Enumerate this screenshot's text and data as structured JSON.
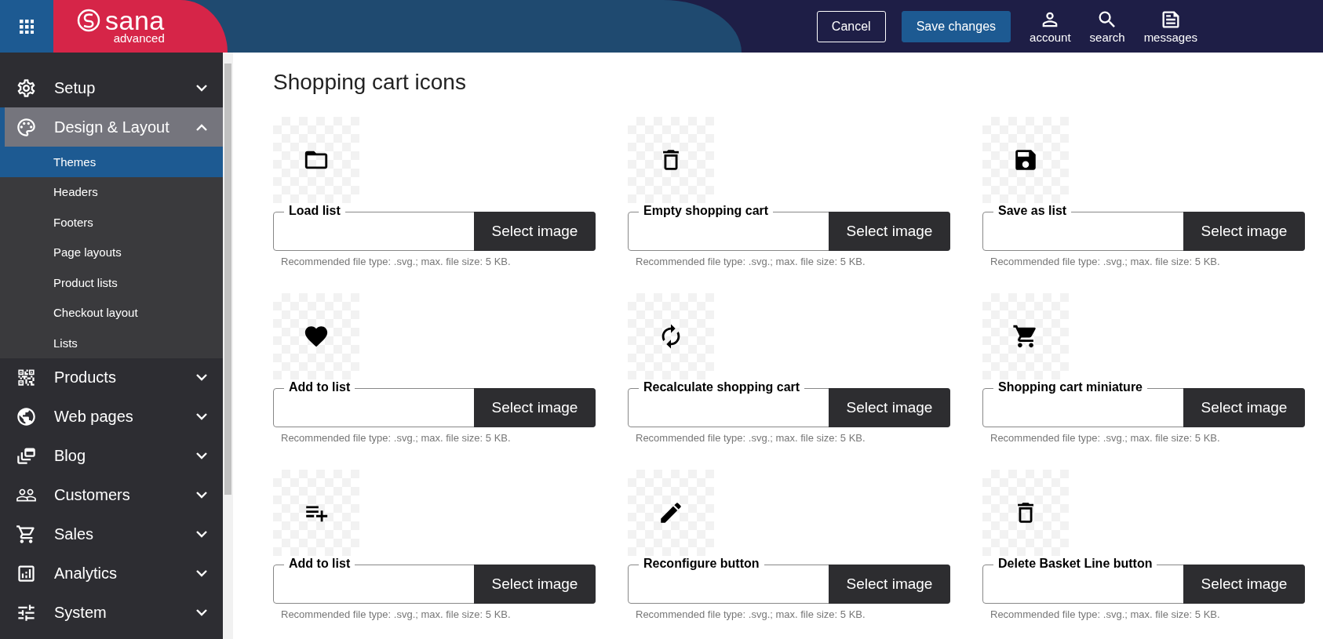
{
  "header": {
    "logo_text": "sana",
    "logo_subtext": "advanced",
    "buttons": [
      {
        "label": "Cancel",
        "kind": "outline"
      },
      {
        "label": "Save changes",
        "kind": "primary"
      }
    ],
    "actions": [
      {
        "label": "account"
      },
      {
        "label": "search"
      },
      {
        "label": "messages"
      }
    ]
  },
  "sidebar": {
    "items": [
      {
        "label": "Setup",
        "expanded": false
      },
      {
        "label": "Design & Layout",
        "expanded": true,
        "children": [
          {
            "label": "Themes",
            "selected": true
          },
          {
            "label": "Headers",
            "selected": false
          },
          {
            "label": "Footers",
            "selected": false
          },
          {
            "label": "Page layouts",
            "selected": false
          },
          {
            "label": "Product lists",
            "selected": false
          },
          {
            "label": "Checkout layout",
            "selected": false
          },
          {
            "label": "Lists",
            "selected": false
          }
        ]
      },
      {
        "label": "Products",
        "expanded": false
      },
      {
        "label": "Web pages",
        "expanded": false
      },
      {
        "label": "Blog",
        "expanded": false
      },
      {
        "label": "Customers",
        "expanded": false
      },
      {
        "label": "Sales",
        "expanded": false
      },
      {
        "label": "Analytics",
        "expanded": false
      },
      {
        "label": "System",
        "expanded": false
      }
    ]
  },
  "section": {
    "title": "Shopping cart icons",
    "fields": [
      {
        "label": "Load list",
        "button": "Select image",
        "hint": "Recommended file type: .svg.; max. file size: 5 KB."
      },
      {
        "label": "Empty shopping cart",
        "button": "Select image",
        "hint": "Recommended file type: .svg.; max. file size: 5 KB."
      },
      {
        "label": "Save as list",
        "button": "Select image",
        "hint": "Recommended file type: .svg.; max. file size: 5 KB."
      },
      {
        "label": "Add to list",
        "button": "Select image",
        "hint": "Recommended file type: .svg.; max. file size: 5 KB."
      },
      {
        "label": "Recalculate shopping cart",
        "button": "Select image",
        "hint": "Recommended file type: .svg.; max. file size: 5 KB."
      },
      {
        "label": "Shopping cart miniature",
        "button": "Select image",
        "hint": "Recommended file type: .svg.; max. file size: 5 KB."
      },
      {
        "label": "Add to list",
        "button": "Select image",
        "hint": "Recommended file type: .svg.; max. file size: 5 KB."
      },
      {
        "label": "Reconfigure button",
        "button": "Select image",
        "hint": "Recommended file type: .svg.; max. file size: 5 KB."
      },
      {
        "label": "Delete Basket Line button",
        "button": "Select image",
        "hint": "Recommended file type: .svg.; max. file size: 5 KB."
      }
    ]
  }
}
